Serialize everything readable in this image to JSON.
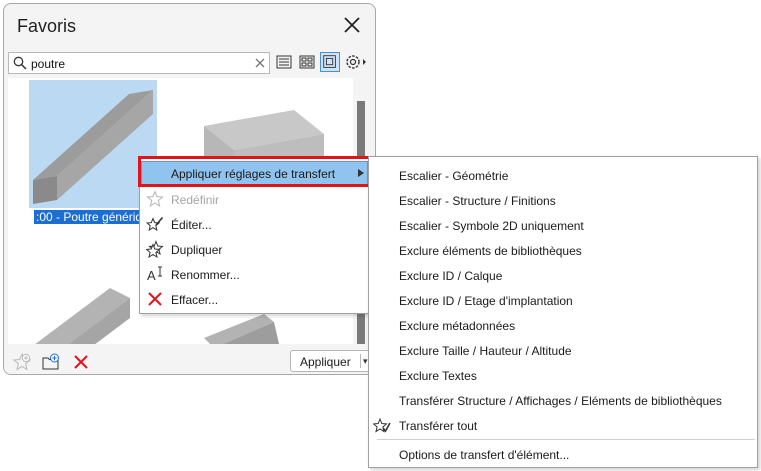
{
  "panel": {
    "title": "Favoris",
    "search": {
      "value": "poutre"
    },
    "items": [
      {
        "caption": ":00 - Poutre générique"
      }
    ],
    "apply_label": "Appliquer"
  },
  "context_menu": {
    "items": [
      {
        "label": "Appliquer réglages de transfert",
        "icon": "none",
        "state": "highlighted",
        "has_submenu": true
      },
      {
        "label": "Redéfinir",
        "icon": "star-icon",
        "state": "disabled"
      },
      {
        "label": "Éditer...",
        "icon": "edit-star-icon",
        "state": "normal"
      },
      {
        "label": "Dupliquer",
        "icon": "duplicate-star-icon",
        "state": "normal"
      },
      {
        "label": "Renommer...",
        "icon": "rename-icon",
        "state": "normal"
      },
      {
        "label": "Effacer...",
        "icon": "delete-x-icon",
        "state": "normal"
      }
    ]
  },
  "submenu": {
    "items": [
      "Escalier - Géométrie",
      "Escalier - Structure / Finitions",
      "Escalier - Symbole 2D uniquement",
      "Exclure éléments de bibliothèques",
      "Exclure ID / Calque",
      "Exclure ID / Etage d'implantation",
      "Exclure métadonnées",
      "Exclure Taille / Hauteur / Altitude",
      "Exclure Textes",
      "Transférer Structure / Affichages / Eléments de bibliothèques",
      "Transférer tout"
    ],
    "footer": "Options de transfert d'élément..."
  },
  "colors": {
    "selection": "#bcd9f4",
    "highlight": "#90c3ee",
    "accent_red": "#e3131b",
    "caption_bg": "#1c6ed2"
  }
}
